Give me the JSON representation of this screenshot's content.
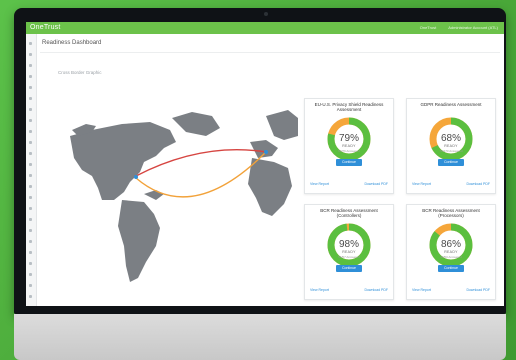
{
  "app": {
    "logo": "OneTrust",
    "top_right": [
      "OneTrust",
      "Administrator Account (ATL)"
    ]
  },
  "page": {
    "title": "Readiness Dashboard",
    "map_title": "Cross Border Graphic"
  },
  "sidebar": {
    "icons": [
      "nav-icon",
      "nav-icon",
      "nav-icon",
      "nav-icon",
      "nav-icon",
      "nav-icon",
      "nav-icon",
      "nav-icon",
      "nav-icon",
      "nav-icon",
      "nav-icon",
      "nav-icon",
      "nav-icon",
      "nav-icon",
      "nav-icon",
      "nav-icon",
      "nav-icon",
      "nav-icon",
      "nav-icon",
      "nav-icon",
      "nav-icon",
      "nav-icon",
      "nav-icon",
      "nav-icon"
    ]
  },
  "colors": {
    "brand": "#6cc24a",
    "accent": "#2f8fd8",
    "gauge_green": "#5bbf3f",
    "gauge_orange": "#f5a63a",
    "route_red": "#d64541",
    "route_orange": "#f2a23a"
  },
  "cards": [
    {
      "title": "EU-U.S. Privacy Shield Readiness Assessment",
      "percent": 79,
      "value": "79%",
      "ready": "READY",
      "sub": "60/76 Answered",
      "continue": "Continue",
      "link_left": "View Report",
      "link_right": "Download PDF"
    },
    {
      "title": "GDPR Readiness Assessment",
      "percent": 68,
      "value": "68%",
      "ready": "READY",
      "sub": "70/173 Answered",
      "continue": "Continue",
      "link_left": "View Report",
      "link_right": "Download PDF"
    },
    {
      "title": "BCR Readiness Assessment (Controllers)",
      "percent": 98,
      "value": "98%",
      "ready": "READY",
      "sub": "56/57 Answered",
      "continue": "Continue",
      "link_left": "View Report",
      "link_right": "Download PDF"
    },
    {
      "title": "BCR Readiness Assessment (Processors)",
      "percent": 86,
      "value": "86%",
      "ready": "READY",
      "sub": "43/50 Answered",
      "continue": "Continue",
      "link_left": "View Report",
      "link_right": "Download PDF"
    }
  ]
}
